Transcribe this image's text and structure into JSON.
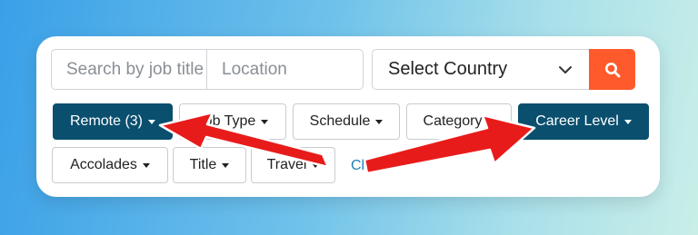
{
  "search": {
    "title_placeholder": "Search by job title",
    "location_placeholder": "Location",
    "country_value": "Select Country"
  },
  "filters": {
    "remote": "Remote (3)",
    "job_type": "Job Type",
    "schedule": "Schedule",
    "category": "Category",
    "career_level": "Career Level",
    "accolades": "Accolades",
    "title": "Title",
    "travel": "Travel",
    "clear": "Cl"
  },
  "icons": {
    "search": "search-icon",
    "country_chevron": "chevron-down-icon",
    "dropdown": "caret-down-icon"
  },
  "colors": {
    "search_button": "#ff5a2b",
    "active_filter": "#0a4f6e",
    "annotation_arrow": "#e81b1b",
    "link": "#1f7fb6"
  }
}
